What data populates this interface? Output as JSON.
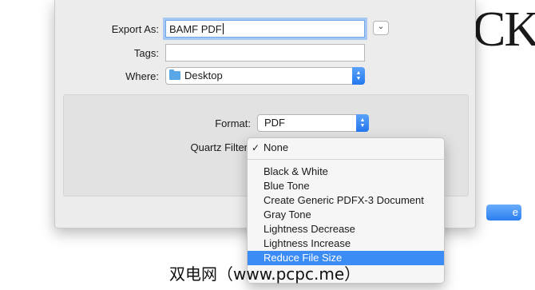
{
  "background_text": "CK",
  "dialog": {
    "export_as_label": "Export As:",
    "export_as_value": "BAMF PDF",
    "tags_label": "Tags:",
    "tags_value": "",
    "where_label": "Where:",
    "where_value": "Desktop",
    "format_label": "Format:",
    "format_value": "PDF",
    "quartz_filter_label": "Quartz Filter",
    "save_button_partial": "e"
  },
  "quartz_menu": {
    "checked_item": "None",
    "items": [
      "Black & White",
      "Blue Tone",
      "Create Generic PDFX-3 Document",
      "Gray Tone",
      "Lightness Decrease",
      "Lightness Increase",
      "Reduce File Size"
    ],
    "highlighted_item": "Reduce File Size"
  },
  "watermark": "双电网（www.pcpc.me）",
  "colors": {
    "accent": "#3b8df5",
    "focus_ring": "#a6c8f3"
  }
}
